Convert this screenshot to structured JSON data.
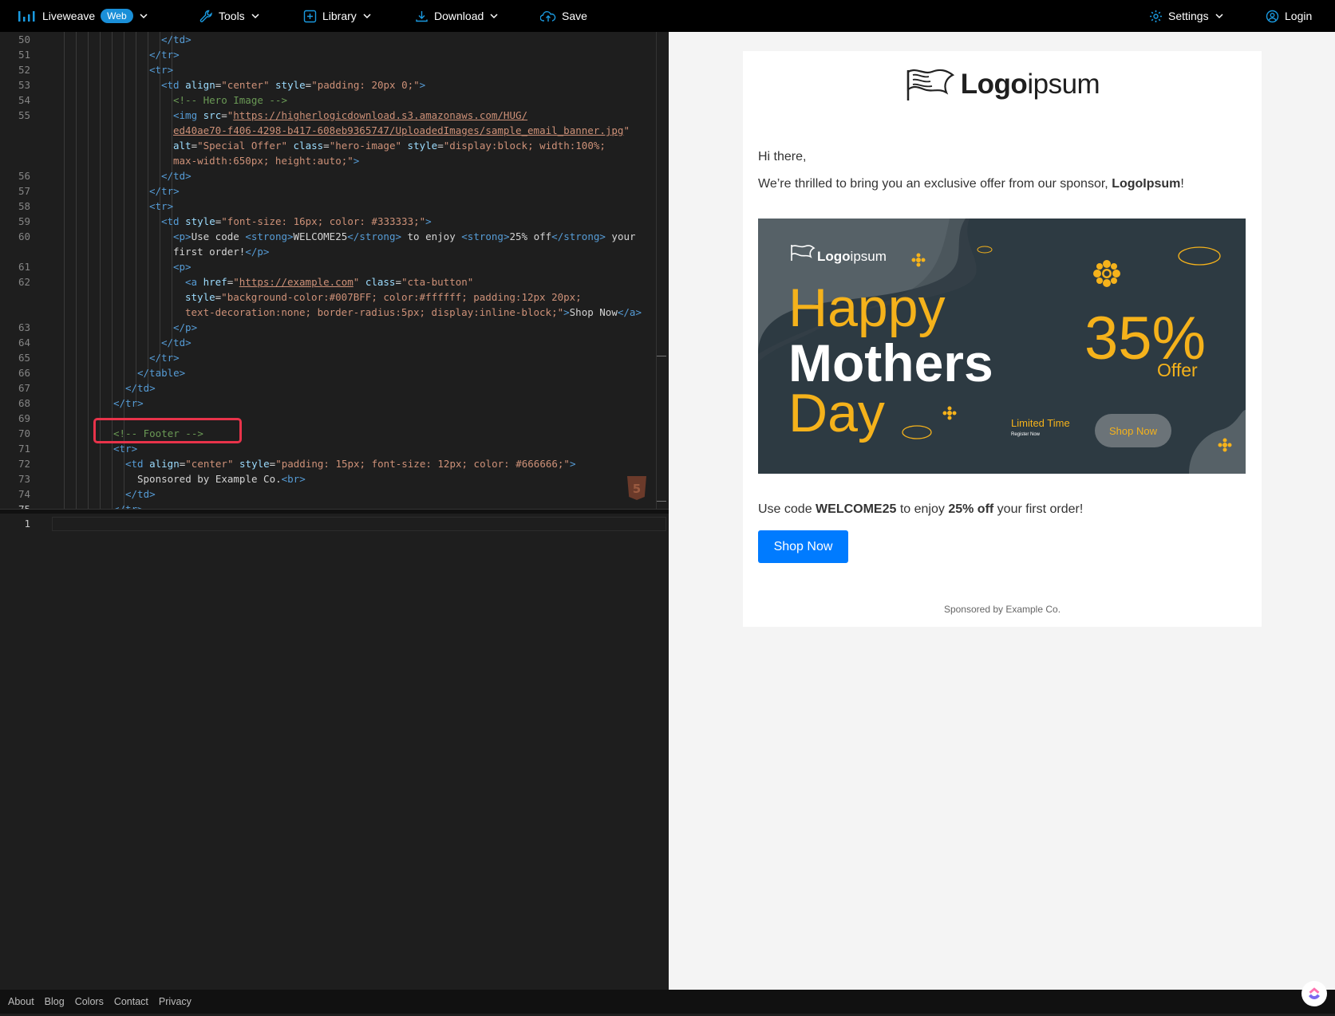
{
  "topbar": {
    "brand": "Liveweave",
    "badge": "Web",
    "tools": "Tools",
    "library": "Library",
    "download": "Download",
    "save": "Save",
    "settings": "Settings",
    "login": "Login"
  },
  "editor": {
    "line_numbers": [
      "50",
      "51",
      "52",
      "53",
      "54",
      "55",
      "",
      "",
      "",
      "56",
      "57",
      "58",
      "59",
      "60",
      "",
      "61",
      "62",
      "",
      "",
      "63",
      "64",
      "65",
      "66",
      "67",
      "68",
      "69",
      "70",
      "71",
      "72",
      "73",
      "74",
      "75"
    ],
    "css_line_numbers": [
      "1"
    ]
  },
  "preview": {
    "logo_bold": "Logo",
    "logo_light": "ipsum",
    "greeting": "Hi there,",
    "intro_prefix": "We’re thrilled to bring you an exclusive offer from our sponsor, ",
    "intro_brand": "LogoIpsum",
    "intro_suffix": "!",
    "banner": {
      "logo_bold": "Logo",
      "logo_light": "ipsum",
      "happy": "Happy",
      "mothers": "Mothers",
      "day": "Day",
      "percent": "35%",
      "offer": "Offer",
      "limited": "Limited Time",
      "register": "Register Now",
      "shop": "Shop Now"
    },
    "code_prefix": "Use code ",
    "code": "WELCOME25",
    "code_mid": " to enjoy ",
    "discount": "25% off",
    "code_suffix": " your first order!",
    "cta": "Shop Now",
    "sponsor": "Sponsored by Example Co."
  },
  "footer": {
    "links": [
      "About",
      "Blog",
      "Colors",
      "Contact",
      "Privacy"
    ]
  },
  "colors": {
    "accent": "#007bff",
    "badge": "#1a8fd8",
    "highlight": "#e8334a",
    "banner_bg": "#2d3a42",
    "banner_yellow": "#f5b21b"
  }
}
